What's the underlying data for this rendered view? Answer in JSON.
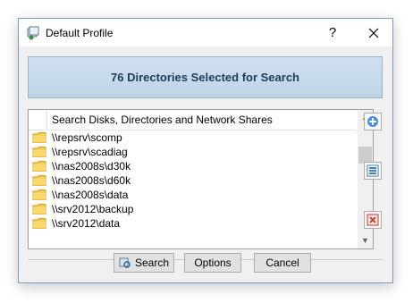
{
  "window": {
    "title": "Default Profile",
    "help_label": "?"
  },
  "banner": {
    "text": "76 Directories Selected for Search"
  },
  "list": {
    "header": "Search Disks, Directories and Network Shares",
    "items": [
      "\\\\repsrv\\scomp",
      "\\\\repsrv\\scadiag",
      "\\\\nas2008s\\d30k",
      "\\\\nas2008s\\d60k",
      "\\\\nas2008s\\data",
      "\\\\srv2012\\backup",
      "\\\\srv2012\\data"
    ]
  },
  "buttons": {
    "search": "Search",
    "options": "Options",
    "cancel": "Cancel"
  },
  "icons": {
    "app": "profile-icon",
    "add": "add-icon",
    "edit": "edit-list-icon",
    "remove": "remove-icon",
    "folder": "folder-icon",
    "search": "search-icon"
  },
  "colors": {
    "banner_text": "#1f3d5c",
    "banner_bg": "#c7dbeb",
    "folder": "#f2c94c"
  }
}
